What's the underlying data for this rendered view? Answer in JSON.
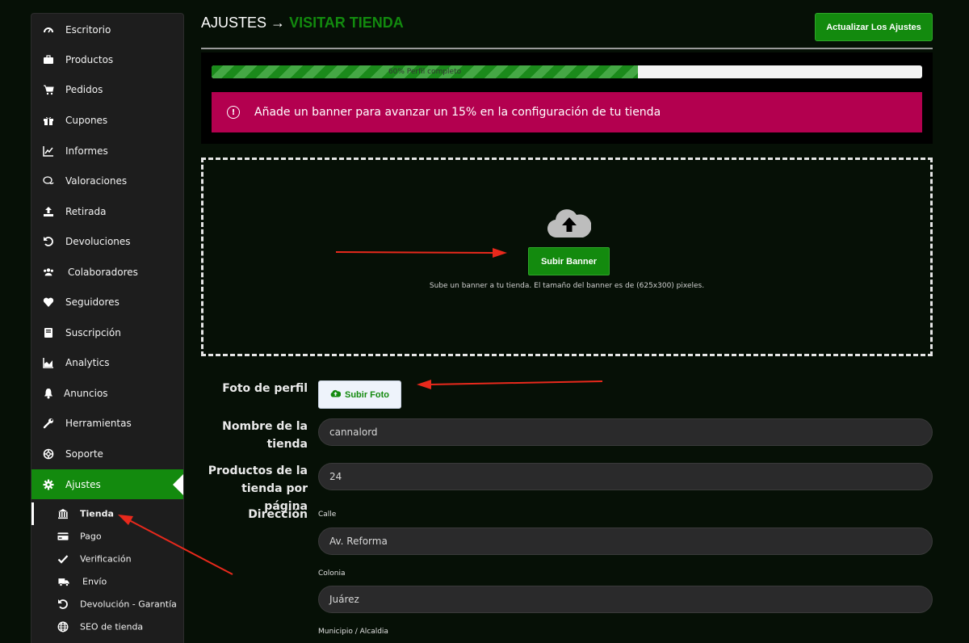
{
  "sidebar": {
    "items": [
      {
        "label": "Escritorio",
        "icon": "dashboard-icon"
      },
      {
        "label": "Productos",
        "icon": "briefcase-icon"
      },
      {
        "label": "Pedidos",
        "icon": "cart-icon"
      },
      {
        "label": "Cupones",
        "icon": "gift-icon"
      },
      {
        "label": "Informes",
        "icon": "chart-line-icon"
      },
      {
        "label": "Valoraciones",
        "icon": "comments-icon"
      },
      {
        "label": "Retirada",
        "icon": "upload-icon"
      },
      {
        "label": "Devoluciones",
        "icon": "undo-icon"
      },
      {
        "label": "Colaboradores",
        "icon": "users-icon"
      },
      {
        "label": "Seguidores",
        "icon": "heart-icon"
      },
      {
        "label": "Suscripción",
        "icon": "book-icon"
      },
      {
        "label": "Analytics",
        "icon": "area-chart-icon"
      },
      {
        "label": "Anuncios",
        "icon": "bell-icon"
      },
      {
        "label": "Herramientas",
        "icon": "wrench-icon"
      },
      {
        "label": "Soporte",
        "icon": "life-ring-icon"
      },
      {
        "label": "Ajustes",
        "icon": "gear-icon"
      }
    ],
    "subitems": [
      {
        "label": "Tienda",
        "icon": "bank-icon"
      },
      {
        "label": "Pago",
        "icon": "credit-card-icon"
      },
      {
        "label": "Verificación",
        "icon": "check-icon"
      },
      {
        "label": "Envío",
        "icon": "truck-icon"
      },
      {
        "label": "Devolución - Garantía",
        "icon": "undo-icon"
      },
      {
        "label": "SEO de tienda",
        "icon": "globe-icon"
      }
    ]
  },
  "header": {
    "title": "AJUSTES",
    "arrow": "→",
    "link": "VISITAR TIENDA",
    "update_button": "Actualizar Los Ajustes"
  },
  "progress": {
    "percent": 60,
    "label": "60% Perfil completo"
  },
  "alert": {
    "icon_glyph": "!",
    "text": "Añade un banner para avanzar un 15% en la configuración de tu tienda"
  },
  "banner": {
    "button": "Subir Banner",
    "help": "Sube un banner a tu tienda. El tamaño del banner es de (625x300) pixeles."
  },
  "form": {
    "photo_label": "Foto de perfil",
    "photo_button": "Subir Foto",
    "store_name_label": "Nombre de la tienda",
    "store_name_value": "cannalord",
    "per_page_label": "Productos de la tienda por página",
    "per_page_value": "24",
    "address_label": "Dirección",
    "street_label": "Calle",
    "street_value": "Av. Reforma",
    "colony_label": "Colonia",
    "colony_value": "Juárez",
    "municipality_label": "Municipio / Alcaldia"
  },
  "colors": {
    "accent": "#138a0e",
    "alert": "#b3004f",
    "background": "#061006",
    "annotation_arrow": "#e8291c"
  }
}
